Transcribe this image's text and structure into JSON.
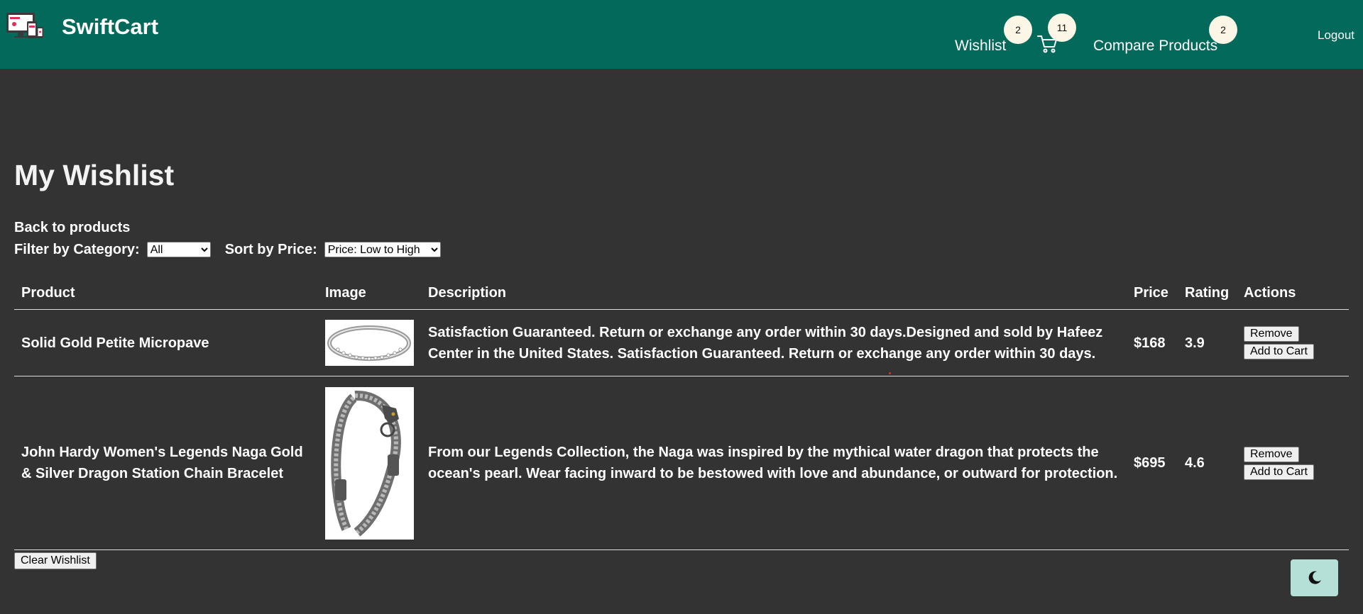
{
  "header": {
    "brand": "SwiftCart",
    "wishlist_label": "Wishlist",
    "wishlist_count": "2",
    "cart_count": "11",
    "compare_label": "Compare Products",
    "compare_count": "2",
    "logout_label": "Logout",
    "bg_color": "#02695b"
  },
  "main": {
    "title": "My Wishlist",
    "back_link": "Back to products",
    "filter_label": "Filter by Category:",
    "filter_selected": "All",
    "sort_label": "Sort by Price:",
    "sort_selected": "Price: Low to High"
  },
  "table": {
    "columns": [
      "Product",
      "Image",
      "Description",
      "Price",
      "Rating",
      "Actions"
    ],
    "rows": [
      {
        "product": "Solid Gold Petite Micropave",
        "image_icon": "ring-image",
        "description": "Satisfaction Guaranteed. Return or exchange any order within 30 days.Designed and sold by Hafeez Center in the United States. Satisfaction Guaranteed. Return or exchange any order within 30 days.",
        "price": "$168",
        "rating": "3.9",
        "remove_label": "Remove",
        "add_label": "Add to Cart"
      },
      {
        "product": "John Hardy Women's Legends Naga Gold & Silver Dragon Station Chain Bracelet",
        "image_icon": "dragon-bracelet-image",
        "description": "From our Legends Collection, the Naga was inspired by the mythical water dragon that protects the ocean's pearl. Wear facing inward to be bestowed with love and abundance, or outward for protection.",
        "price": "$695",
        "rating": "4.6",
        "remove_label": "Remove",
        "add_label": "Add to Cart"
      }
    ]
  },
  "footer": {
    "clear_label": "Clear Wishlist",
    "theme_toggle_icon": "moon-icon"
  }
}
